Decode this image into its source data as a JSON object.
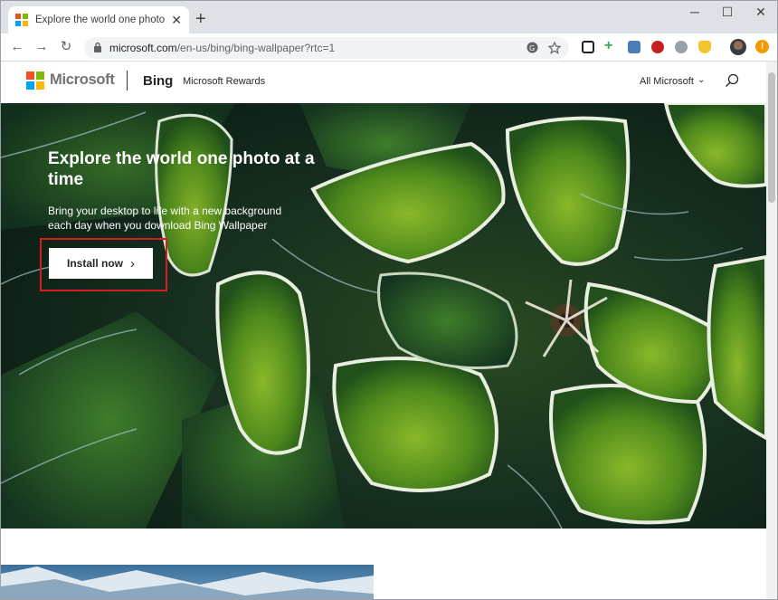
{
  "browser": {
    "tab_title": "Explore the world one photo at a",
    "tab_close": "✕",
    "new_tab": "+",
    "window_controls": {
      "minimize": "─",
      "maximize": "☐",
      "close": "✕"
    },
    "nav": {
      "back": "←",
      "forward": "→",
      "reload": "↻"
    },
    "url_host": "microsoft.com",
    "url_path": "/en-us/bing/bing-wallpaper?rtc=1",
    "update_badge": "!"
  },
  "site": {
    "brand": "Microsoft",
    "product": "Bing",
    "rewards_link": "Microsoft Rewards",
    "all_microsoft": "All Microsoft",
    "chevron": "⌄"
  },
  "hero": {
    "title": "Explore the world one photo at a time",
    "subtitle": "Bring your desktop to life with a new background each day when you download Bing Wallpaper",
    "cta_label": "Install now",
    "cta_chevron": "›"
  },
  "colors": {
    "ms_red": "#f25022",
    "ms_green": "#7fba00",
    "ms_blue": "#00a4ef",
    "ms_yellow": "#ffb900",
    "highlight_red": "#d21f1f"
  },
  "icons": [
    "lock-icon",
    "translate-icon",
    "star-icon",
    "search-icon",
    "microsoft-logo-icon"
  ]
}
